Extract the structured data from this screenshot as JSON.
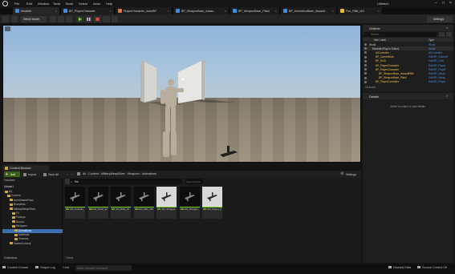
{
  "menubar": {
    "items": [
      "File",
      "Edit",
      "Window",
      "Tools",
      "Build",
      "Select",
      "Actor",
      "Help"
    ],
    "project_name": "Ultimte1"
  },
  "tabs": [
    {
      "label": "Meatlatt",
      "color": "#3a8fe0"
    },
    {
      "label": "BP_PlayerCharacter",
      "color": "#3a8fe0"
    },
    {
      "label": "PlayerCharacter_AnimBP",
      "color": "#e07a3a"
    },
    {
      "label": "BP_WeaponBase_Assau...",
      "color": "#3a8fe0"
    },
    {
      "label": "BP_WeaponBase_Pistol",
      "color": "#3a8fe0"
    },
    {
      "label": "BP_AnimationBase_Assault...",
      "color": "#3a8fe0"
    },
    {
      "label": "Fire_Rifle_MG",
      "color": "#e0c23a"
    }
  ],
  "toolbar": {
    "select_mode": "Select Mode",
    "settings": "Settings"
  },
  "outliner": {
    "title": "Outliner",
    "search_placeholder": "Search...",
    "col_item": "Item Label",
    "col_type": "Type",
    "rows": [
      {
        "name": "World",
        "type": "World",
        "indent": 0,
        "color": "#ccc"
      },
      {
        "name": "Meatlatt (Play in Editor)",
        "type": "World",
        "indent": 1,
        "color": "#ccc"
      },
      {
        "name": "AIController",
        "type": "AIController",
        "indent": 2,
        "color": "#f0c14b"
      },
      {
        "name": "BP_GameMode",
        "type": "Edit BP_GameM",
        "indent": 2,
        "color": "#f0c14b"
      },
      {
        "name": "BP_HUD",
        "type": "Edit BP_HUD",
        "indent": 2,
        "color": "#f0c14b"
      },
      {
        "name": "BP_PlayerCharacter",
        "type": "Edit BP_Player",
        "indent": 2,
        "color": "#f0c14b"
      },
      {
        "name": "BP_PlayerCharacter",
        "type": "Edit BP_Player",
        "indent": 2,
        "color": "#f0c14b"
      },
      {
        "name": "BP_WeaponBase_AssaultRifle",
        "type": "Edit BP_Weap",
        "indent": 3,
        "color": "#f0c14b"
      },
      {
        "name": "BP_WeaponBase_Pistol",
        "type": "Edit BP_Weap",
        "indent": 3,
        "color": "#f0c14b"
      },
      {
        "name": "BP_PlayerController",
        "type": "Edit BP_Player",
        "indent": 2,
        "color": "#f0c14b"
      }
    ],
    "count": "18 actors"
  },
  "details": {
    "title": "Details",
    "empty_message": "Select an object to view details."
  },
  "content_browser": {
    "tab_label": "Content Browser",
    "add_label": "Add",
    "import_label": "Import",
    "save_all_label": "Save All",
    "settings_label": "Settings",
    "breadcrumb": [
      "All",
      "Content",
      "MilitaryWeapSilver",
      "Weapons",
      "Animations"
    ],
    "search_value": "fire",
    "search_paths_placeholder": "Search Paths",
    "favorites_label": "Favorites",
    "root_label": "Ultimte1",
    "tree": [
      {
        "label": "All",
        "indent": 0,
        "selected": false
      },
      {
        "label": "Content",
        "indent": 1,
        "selected": false
      },
      {
        "label": "AnimStarterPack",
        "indent": 2,
        "selected": false
      },
      {
        "label": "Blueprints",
        "indent": 2,
        "selected": false
      },
      {
        "label": "MilitaryWeapSilver",
        "indent": 2,
        "selected": false
      },
      {
        "label": "FX",
        "indent": 3,
        "selected": false
      },
      {
        "label": "Pickups",
        "indent": 3,
        "selected": false
      },
      {
        "label": "Sound",
        "indent": 3,
        "selected": false
      },
      {
        "label": "Weapons",
        "indent": 3,
        "selected": false
      },
      {
        "label": "Animations",
        "indent": 4,
        "selected": true
      },
      {
        "label": "Materials",
        "indent": 4,
        "selected": false
      },
      {
        "label": "Textures",
        "indent": 4,
        "selected": false
      },
      {
        "label": "StarterContent",
        "indent": 2,
        "selected": false
      }
    ],
    "collections_label": "Collections",
    "items_count": "7 items",
    "assets": [
      {
        "label": "AM_Assault_Launcher_W",
        "bright": false
      },
      {
        "label": "AM_Pistol_W",
        "bright": false
      },
      {
        "label": "AM_Rifle_W",
        "bright": false
      },
      {
        "label": "AM_Rifle_MG",
        "bright": false
      },
      {
        "label": "AM_Shotgun_Launcher_W",
        "bright": true
      },
      {
        "label": "AM_Shotgun_W",
        "bright": false
      },
      {
        "label": "AM_Sniper_Rifle_W",
        "bright": true
      }
    ]
  },
  "statusbar": {
    "content_drawer": "Content Drawer",
    "output_log": "Output Log",
    "cmd": "Cmd",
    "console_placeholder": "Enter Console Command",
    "derived_data": "Derived Data",
    "source_control": "Source Control Off"
  }
}
